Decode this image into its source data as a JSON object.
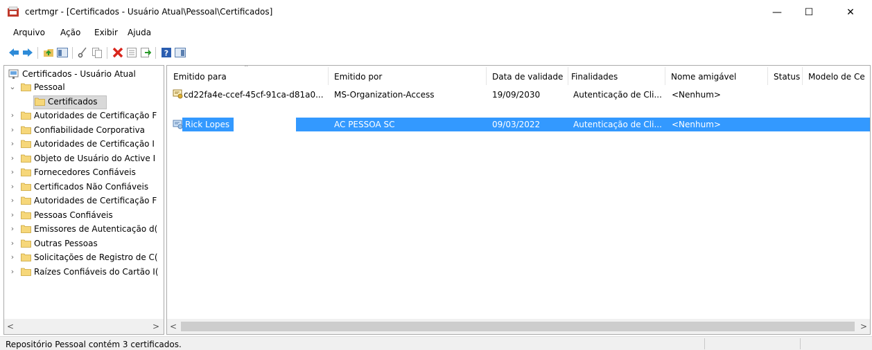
{
  "window": {
    "title": "certmgr - [Certificados - Usuário Atual\\Pessoal\\Certificados]",
    "minimize": "—",
    "maximize": "☐",
    "close": "✕"
  },
  "menu": [
    "Arquivo",
    "Ação",
    "Exibir",
    "Ajuda"
  ],
  "toolbar_icons": [
    "back-icon",
    "forward-icon",
    "up-folder-icon",
    "show-tree-icon",
    "cut-icon",
    "copy-icon",
    "delete-icon",
    "properties-icon",
    "export-icon",
    "help-icon",
    "view-icon"
  ],
  "tree": {
    "root": "Certificados - Usuário Atual",
    "items": [
      {
        "label": "Pessoal",
        "expanded": true
      },
      {
        "label": "Certificados",
        "selected": true
      },
      {
        "label": "Autoridades de Certificação F"
      },
      {
        "label": "Confiabilidade Corporativa"
      },
      {
        "label": "Autoridades de Certificação I"
      },
      {
        "label": "Objeto de Usuário do Active I"
      },
      {
        "label": "Fornecedores Confiáveis"
      },
      {
        "label": "Certificados Não Confiáveis"
      },
      {
        "label": "Autoridades de Certificação F"
      },
      {
        "label": "Pessoas Confiáveis"
      },
      {
        "label": "Emissores de Autenticação d("
      },
      {
        "label": "Outras Pessoas"
      },
      {
        "label": "Solicitações de Registro de C("
      },
      {
        "label": "Raízes Confiáveis do Cartão I("
      }
    ]
  },
  "list": {
    "columns": [
      "Emitido para",
      "Emitido por",
      "Data de validade",
      "Finalidades",
      "Nome amigável",
      "Status",
      "Modelo de Ce"
    ],
    "rows": [
      {
        "issued_to": "cd22fa4e-ccef-45cf-91ca-d81a0...",
        "issued_by": "MS-Organization-Access",
        "expires": "19/09/2030",
        "purposes": "Autenticação de Cli...",
        "friendly": "<Nenhum>",
        "selected": false
      },
      {
        "issued_to": "Rick Lopes",
        "issued_by": "AC PESSOA SC",
        "expires": "09/03/2022",
        "purposes": "Autenticação de Cli...",
        "friendly": "<Nenhum>",
        "selected": true
      }
    ]
  },
  "status": {
    "text": "Repositório Pessoal contém 3 certificados."
  },
  "colors": {
    "selection": "#3399ff",
    "folder": "#f6d77a"
  }
}
